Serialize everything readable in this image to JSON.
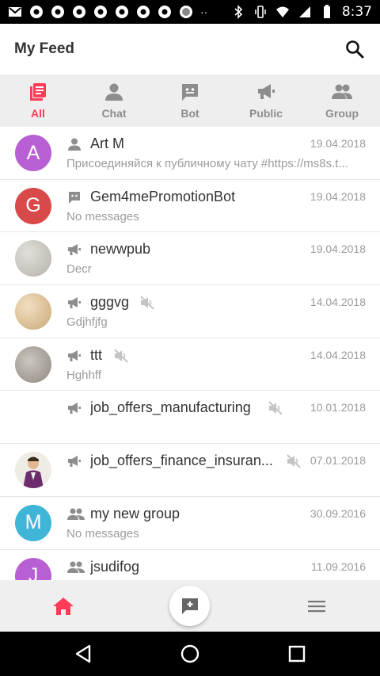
{
  "status": {
    "time": "8:37"
  },
  "appbar": {
    "title": "My Feed"
  },
  "tabs": [
    {
      "label": "All",
      "active": true
    },
    {
      "label": "Chat",
      "active": false
    },
    {
      "label": "Bot",
      "active": false
    },
    {
      "label": "Public",
      "active": false
    },
    {
      "label": "Group",
      "active": false
    }
  ],
  "feed": [
    {
      "name": "Art M",
      "date": "19.04.2018",
      "preview": "Присоединяйся к публичному чату #https://ms8s.t...",
      "type": "person",
      "avatar_letter": "A",
      "avatar_color": "#b75fd3",
      "muted": false
    },
    {
      "name": "Gem4mePromotionBot",
      "date": "19.04.2018",
      "preview": "No messages",
      "type": "bot",
      "avatar_letter": "G",
      "avatar_color": "#d84a4a",
      "muted": false
    },
    {
      "name": "newwpub",
      "date": "19.04.2018",
      "preview": "Decr",
      "type": "public",
      "avatar_letter": "",
      "avatar_color": "#c9c6c0",
      "muted": false
    },
    {
      "name": "gggvg",
      "date": "14.04.2018",
      "preview": "Gdjhfjfg",
      "type": "public",
      "avatar_letter": "",
      "avatar_color": "#dcc39c",
      "muted": true
    },
    {
      "name": "ttt",
      "date": "14.04.2018",
      "preview": "Hghhff",
      "type": "public",
      "avatar_letter": "",
      "avatar_color": "#b0aaa3",
      "muted": true
    },
    {
      "name": "job_offers_manufacturing",
      "date": "10.01.2018",
      "preview": "",
      "type": "public",
      "avatar_letter": "",
      "avatar_color": "",
      "muted": true
    },
    {
      "name": "job_offers_finance_insuran...",
      "date": "07.01.2018",
      "preview": "",
      "type": "public",
      "avatar_letter": "",
      "avatar_color": "#e8e4dc",
      "muted": true
    },
    {
      "name": "my new group",
      "date": "30.09.2016",
      "preview": "No messages",
      "type": "group",
      "avatar_letter": "M",
      "avatar_color": "#3fb6d8",
      "muted": false
    },
    {
      "name": "jsudifog",
      "date": "11.09.2016",
      "preview": "",
      "type": "group",
      "avatar_letter": "J",
      "avatar_color": "#b75fd3",
      "muted": false
    }
  ],
  "colors": {
    "accent": "#ff3b58",
    "muted_text": "#9b9b9b",
    "tab_bg": "#eeeeee"
  }
}
